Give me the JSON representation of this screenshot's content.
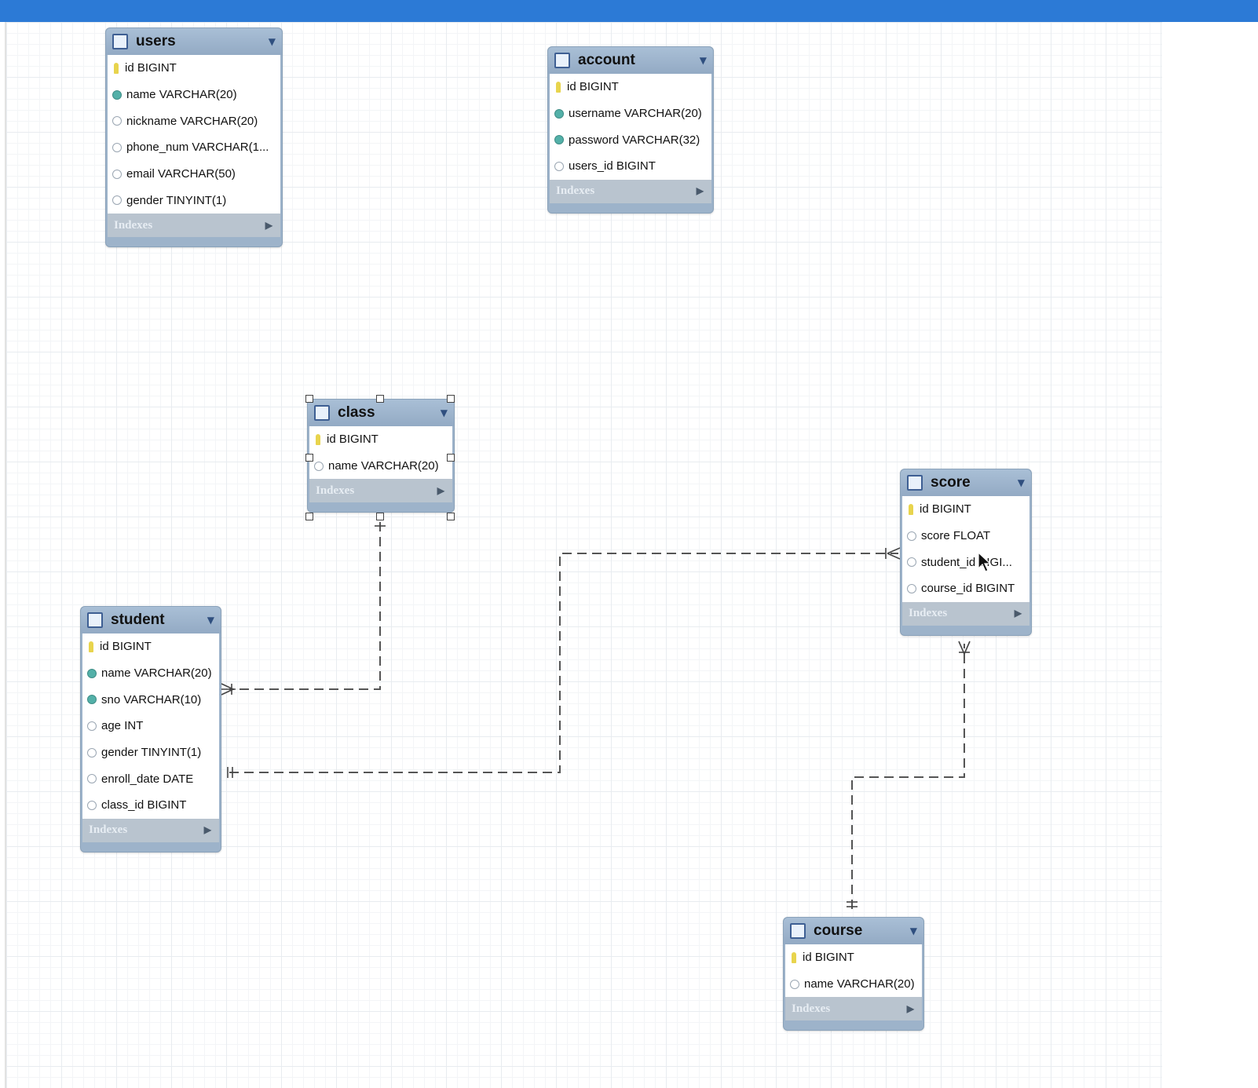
{
  "tables": [
    {
      "name": "users",
      "columns": [
        {
          "text": "id BIGINT",
          "icon": "primary-key"
        },
        {
          "text": "name VARCHAR(20)",
          "icon": "not-null"
        },
        {
          "text": "nickname VARCHAR(20)",
          "icon": "nullable"
        },
        {
          "text": "phone_num VARCHAR(1...",
          "icon": "nullable"
        },
        {
          "text": "email VARCHAR(50)",
          "icon": "nullable"
        },
        {
          "text": "gender TINYINT(1)",
          "icon": "nullable"
        }
      ],
      "indexes_label": "Indexes"
    },
    {
      "name": "account",
      "columns": [
        {
          "text": "id BIGINT",
          "icon": "primary-key"
        },
        {
          "text": "username VARCHAR(20)",
          "icon": "not-null"
        },
        {
          "text": "password VARCHAR(32)",
          "icon": "not-null"
        },
        {
          "text": "users_id BIGINT",
          "icon": "nullable"
        }
      ],
      "indexes_label": "Indexes"
    },
    {
      "name": "class",
      "columns": [
        {
          "text": "id BIGINT",
          "icon": "primary-key"
        },
        {
          "text": "name VARCHAR(20)",
          "icon": "nullable"
        }
      ],
      "indexes_label": "Indexes",
      "selected": true
    },
    {
      "name": "score",
      "columns": [
        {
          "text": "id BIGINT",
          "icon": "primary-key"
        },
        {
          "text": "score FLOAT",
          "icon": "nullable"
        },
        {
          "text": "student_id BIGI...",
          "icon": "nullable"
        },
        {
          "text": "course_id BIGINT",
          "icon": "nullable"
        }
      ],
      "indexes_label": "Indexes"
    },
    {
      "name": "student",
      "columns": [
        {
          "text": "id BIGINT",
          "icon": "primary-key"
        },
        {
          "text": "name VARCHAR(20)",
          "icon": "not-null"
        },
        {
          "text": "sno VARCHAR(10)",
          "icon": "not-null"
        },
        {
          "text": "age INT",
          "icon": "nullable"
        },
        {
          "text": "gender TINYINT(1)",
          "icon": "nullable"
        },
        {
          "text": "enroll_date DATE",
          "icon": "nullable"
        },
        {
          "text": "class_id BIGINT",
          "icon": "nullable"
        }
      ],
      "indexes_label": "Indexes"
    },
    {
      "name": "course",
      "columns": [
        {
          "text": "id BIGINT",
          "icon": "primary-key"
        },
        {
          "text": "name VARCHAR(20)",
          "icon": "nullable"
        }
      ],
      "indexes_label": "Indexes"
    }
  ],
  "relationships": [
    {
      "from": "class",
      "to": "student",
      "cardinality": "one-to-many"
    },
    {
      "from": "student",
      "to": "score",
      "cardinality": "one-to-many"
    },
    {
      "from": "course",
      "to": "score",
      "cardinality": "one-to-many"
    }
  ],
  "colors": {
    "titlebar": "#2c7ad6",
    "table_header": "#9db3ca",
    "relationship_line": "#555555",
    "primary_key_icon": "#e8d44d",
    "not_null_icon": "#53b0a8"
  }
}
